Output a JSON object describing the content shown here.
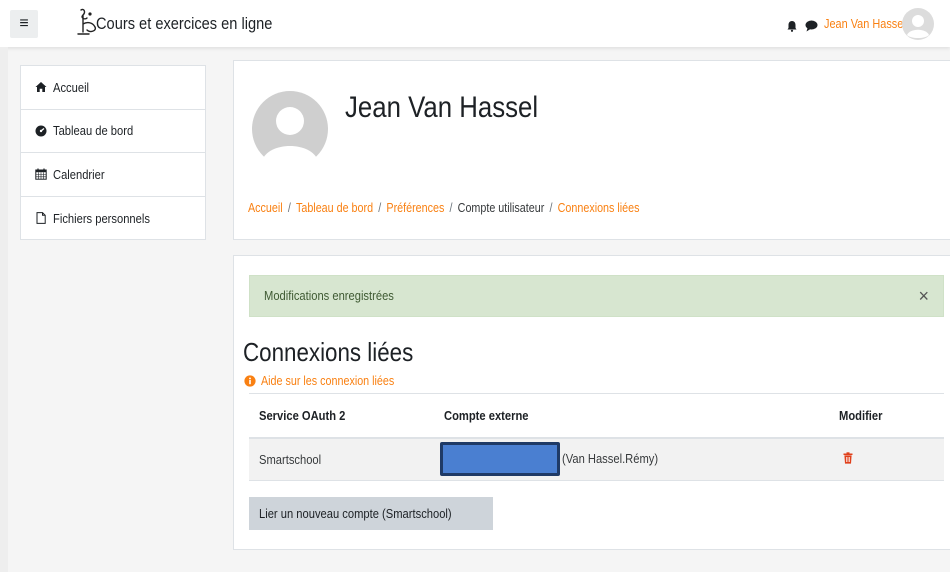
{
  "header": {
    "site_name": "Cours et exercices en ligne",
    "user_name": "Jean Van Hassel"
  },
  "icons": {
    "menu": "hamburger-icon",
    "logo": "site-logo",
    "notifications": "bell-icon",
    "messages": "chat-icon",
    "user": "user-avatar",
    "home": "home-icon",
    "dashboard": "dashboard-icon",
    "calendar": "calendar-icon",
    "files": "file-icon",
    "help": "info-circle-icon",
    "delete": "trash-icon",
    "close": "close-icon"
  },
  "colors": {
    "accent": "#f98012",
    "alert_bg": "#d7e6d0",
    "button_bg": "#ced4da"
  },
  "sidebar": {
    "items": [
      {
        "label": "Accueil"
      },
      {
        "label": "Tableau de bord"
      },
      {
        "label": "Calendrier"
      },
      {
        "label": "Fichiers personnels"
      }
    ]
  },
  "profile": {
    "name": "Jean Van Hassel"
  },
  "breadcrumb": {
    "items": [
      {
        "label": "Accueil"
      },
      {
        "label": "Tableau de bord"
      },
      {
        "label": "Préférences"
      },
      {
        "label": "Compte utilisateur"
      },
      {
        "label": "Connexions liées"
      }
    ],
    "separator": "/"
  },
  "alert": {
    "message": "Modifications enregistrées",
    "close": "×"
  },
  "main": {
    "heading": "Connexions liées",
    "help_link": "Aide sur les connexion liées",
    "table": {
      "headers": [
        "Service OAuth 2",
        "Compte externe",
        "Modifier"
      ],
      "rows": [
        {
          "service": "Smartschool",
          "account_suffix": "(Van Hassel.Rémy)"
        }
      ]
    },
    "link_button": "Lier un nouveau compte (Smartschool)"
  }
}
